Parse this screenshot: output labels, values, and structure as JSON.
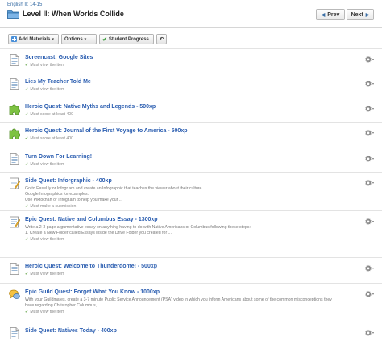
{
  "header": {
    "breadcrumb": "English II: 14-15",
    "title": "Level II: When Worlds Collide",
    "prev_label": "Prev",
    "next_label": "Next",
    "prev_arrow": "◀",
    "next_arrow": "▶"
  },
  "toolbar": {
    "add_materials": "Add Materials",
    "options": "Options",
    "student_progress": "Student Progress",
    "back_arrow": "↶",
    "caret": "▾",
    "check": "✔"
  },
  "icons": {
    "page": "page-icon",
    "puzzle": "puzzle-icon",
    "assignment": "assignment-icon",
    "discussion": "discussion-icon",
    "gear": "gear-icon"
  },
  "colors": {
    "link": "#2a5db0",
    "accent": "#3a6ea5",
    "check": "#6aa84f",
    "puzzle": "#7dc242"
  },
  "items": [
    {
      "title": "Screencast: Google Sites",
      "requirement": "Must view the item",
      "desc": []
    },
    {
      "title": "Lies My Teacher Told Me",
      "requirement": "Must view the item",
      "desc": []
    },
    {
      "title": "Heroic Quest: Native Myths and Legends - 500xp",
      "requirement": "Must score at least 400",
      "desc": []
    },
    {
      "title": "Heroic Quest: Journal of the First Voyage to America - 500xp",
      "requirement": "Must score at least 400",
      "desc": []
    },
    {
      "title": "Turn Down For Learning!",
      "requirement": "Must view the item",
      "desc": []
    },
    {
      "title": "Side Quest: Inforgraphic - 400xp",
      "requirement": "Must make a submission",
      "desc": [
        "Go to Easel.ly or Infogr.am and create an Infographic that teaches the viewer about their culture.",
        "Google Infographics for examples.",
        "Use Piktochart or Infogr.am to help you make your ..."
      ]
    },
    {
      "title": "Epic Quest: Native and Columbus Essay - 1300xp",
      "requirement": "Must view the item",
      "desc": [
        "Write a 2-3 page argumentative essay on anything having to do with Native Americans or Columbus following these steps:",
        "1. Create a New Folder called Essays inside the Drive Folder you created for ..."
      ]
    },
    {
      "title": "Heroic Quest: Welcome to Thunderdome! - 500xp",
      "requirement": "Must view the item",
      "desc": []
    },
    {
      "title": "Epic Guild Quest: Forget What You Know - 1000xp",
      "requirement": "Must view the item",
      "desc": [
        "With your Guildmates, create a 3-7 minute Public Service Announcement (PSA) video in which you inform Americans about some of the common misconceptions they",
        "have regarding Christopher Columbus,..."
      ]
    },
    {
      "title": "Side Quest: Natives Today - 400xp",
      "requirement": "",
      "desc": []
    }
  ]
}
